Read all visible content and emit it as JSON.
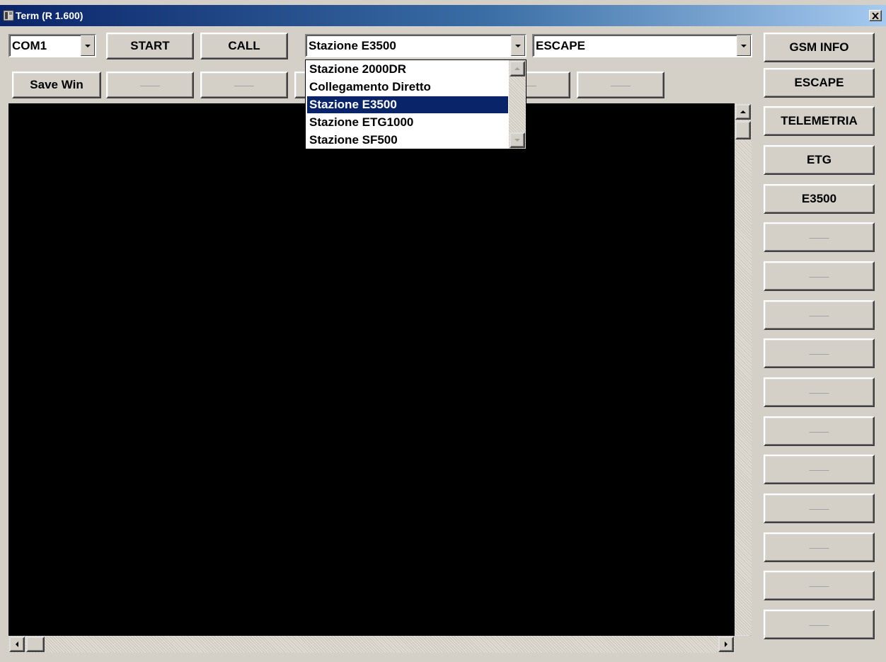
{
  "window": {
    "title": "Term (R 1.600)",
    "close_label": "✕"
  },
  "toolbar": {
    "port_select_value": "COM1",
    "start_label": "START",
    "call_label": "CALL",
    "station_select_value": "Stazione E3500",
    "command_select_value": "ESCAPE",
    "save_win_label": "Save Win",
    "empty_label": "——"
  },
  "station_dropdown": {
    "options": [
      "Stazione 2000DR",
      "Collegamento Diretto",
      "Stazione E3500",
      "Stazione ETG1000",
      "Stazione SF500"
    ],
    "selected_index": 2
  },
  "side_panel": {
    "buttons": [
      "GSM INFO",
      "ESCAPE",
      "TELEMETRIA",
      "ETG",
      "E3500",
      "——",
      "——",
      "——",
      "——",
      "——",
      "——",
      "——",
      "——",
      "——",
      "——",
      "——"
    ]
  },
  "colors": {
    "title_bar_start": "#0a246a",
    "title_bar_end": "#a6caf0",
    "face": "#d4d0c8",
    "terminal_bg": "#000000",
    "selection": "#0a246a"
  },
  "icons": {
    "app": "terminal-app-icon",
    "close": "close-icon",
    "dropdown_arrow": "chevron-down-icon"
  }
}
